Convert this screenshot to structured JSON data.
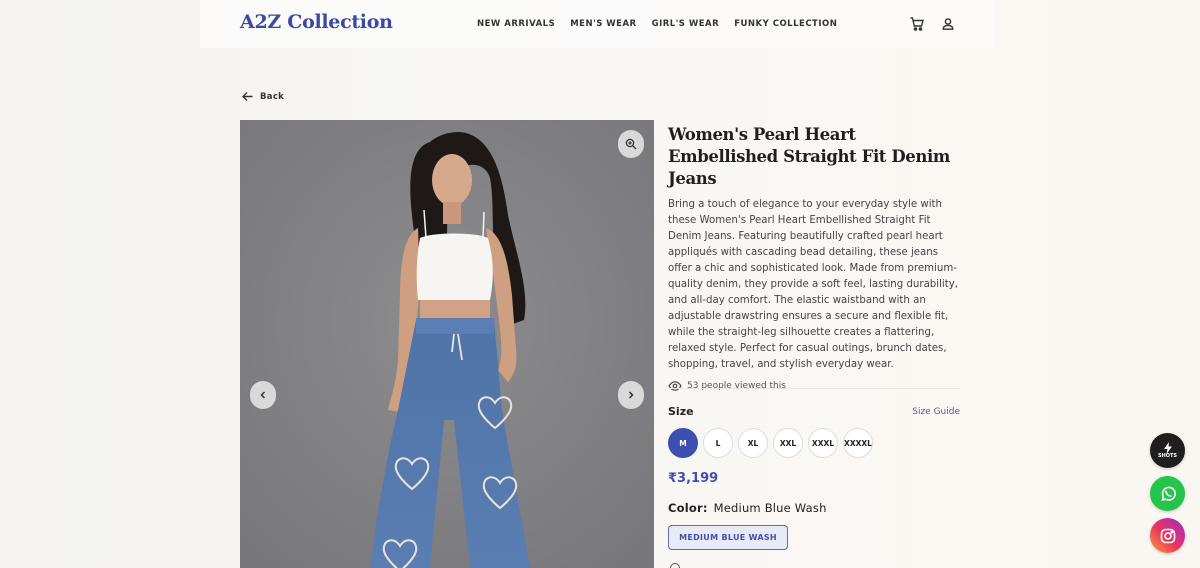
{
  "header": {
    "logo": "A2Z Collection",
    "nav": [
      "NEW ARRIVALS",
      "MEN'S WEAR",
      "GIRL'S WEAR",
      "FUNKY COLLECTION"
    ],
    "icons": [
      "cart-icon",
      "user-icon"
    ]
  },
  "back": {
    "label": "Back"
  },
  "product": {
    "title": "Women's Pearl Heart Embellished Straight Fit Denim Jeans",
    "description": "Bring a touch of elegance to your everyday style with these Women's Pearl Heart Embellished Straight Fit Denim Jeans. Featuring beautifully crafted pearl heart appliqués with cascading bead detailing, these jeans offer a chic and sophisticated look. Made from premium-quality denim, they provide a soft feel, lasting durability, and all-day comfort. The elastic waistband with an adjustable drawstring ensures a secure and flexible fit, while the straight-leg silhouette creates a flattering, relaxed style. Perfect for casual outings, brunch dates, shopping, travel, and stylish everyday wear.",
    "views_text": "53 people viewed this",
    "size_label": "Size",
    "size_guide": "Size Guide",
    "sizes": [
      "M",
      "L",
      "XL",
      "XXL",
      "XXXL",
      "XXXXL"
    ],
    "selected_size": "M",
    "price": "₹3,199",
    "color_label": "Color:",
    "color_value": "Medium Blue Wash",
    "color_options": [
      "MEDIUM BLUE WASH"
    ]
  },
  "floating": {
    "shots_label": "SHOTS"
  },
  "colors": {
    "brand": "#3a4aa3",
    "accent": "#3f4fb0",
    "whatsapp": "#26c34d",
    "gallery_bg": "#838285"
  }
}
